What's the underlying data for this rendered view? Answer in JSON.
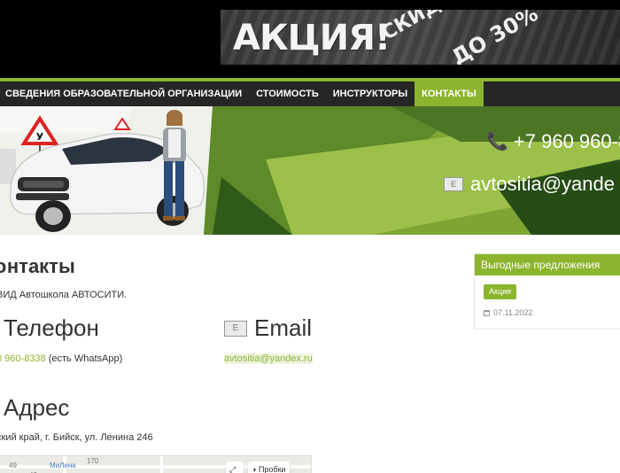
{
  "promo": {
    "title": "АКЦИЯ!",
    "subtitle": "СКИДКА!",
    "discount": "ДО 30%"
  },
  "nav": {
    "items": [
      {
        "label": "СВЕДЕНИЯ ОБРАЗОВАТЕЛЬНОЙ ОРГАНИЗАЦИИ"
      },
      {
        "label": "СТОИМОСТЬ"
      },
      {
        "label": "ИНСТРУКТОРЫ"
      },
      {
        "label": "КОНТАКТЫ",
        "active": true
      }
    ]
  },
  "hero": {
    "sign_letter": "У",
    "phone": "+7 960 960-8",
    "email": "avtositia@yande",
    "phone_icon": "phone-icon",
    "email_icon": "envelope-icon"
  },
  "content": {
    "title": "нтакты",
    "org_line": "ВИД Автошкола АВТОСИТИ.",
    "phone_heading": "Телефон",
    "phone_number": "0 960-8338",
    "phone_note": "(есть WhatsApp)",
    "email_heading": "Email",
    "email_link": "avtositia@yandex.ru",
    "address_heading": "Адрес",
    "address_text": "ский край, г. Бийск, ул. Ленина 246",
    "map": {
      "labels": [
        "49",
        "МиЛена",
        "170",
        "42"
      ],
      "traffic_button": "Пробки"
    }
  },
  "sidebar": {
    "widget_title": "Выгодные предложения",
    "badge": "Акция",
    "date": "07.11.2022"
  },
  "colors": {
    "accent": "#8db42f",
    "nav_bg": "#262626",
    "header_bg": "#000000"
  }
}
